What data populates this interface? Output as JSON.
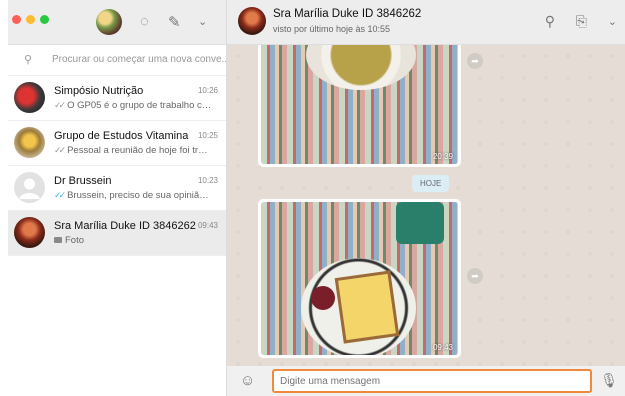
{
  "sidebar": {
    "search_placeholder": "Procurar ou começar uma nova conve...",
    "chats": [
      {
        "name": "Simpósio Nutrição",
        "time": "10:26",
        "preview": "O GP05 é o grupo de trabalho com ...",
        "tick": "✓✓",
        "tick_color": "gray"
      },
      {
        "name": "Grupo de Estudos Vitamina",
        "time": "10:25",
        "preview": "Pessoal a reunião de hoje foi transf...",
        "tick": "✓✓",
        "tick_color": "gray"
      },
      {
        "name": "Dr Brussein",
        "time": "10:23",
        "preview": "Brussein, preciso de sua opinião co...",
        "tick": "✓✓",
        "tick_color": "blue"
      },
      {
        "name": "Sra Marília Duke ID 3846262",
        "time": "09:43",
        "preview": "Foto",
        "icon": "camera-icon"
      }
    ]
  },
  "conversation": {
    "contact_name": "Sra Marília Duke ID 3846262",
    "status": "visto por último hoje às 10:55",
    "messages": [
      {
        "type": "photo",
        "time": "20:39",
        "subject": "soup-bowl-photo"
      },
      {
        "type": "day-separator",
        "label": "HOJE"
      },
      {
        "type": "photo",
        "time": "09:43",
        "subject": "breakfast-photo"
      }
    ],
    "input_placeholder": "Digite uma mensagem"
  },
  "colors": {
    "accent_input_border": "#f08a3a",
    "read_tick": "#4fb6ec",
    "traffic_red": "#fc5f57",
    "traffic_yellow": "#fdbc2e",
    "traffic_green": "#28c840"
  }
}
